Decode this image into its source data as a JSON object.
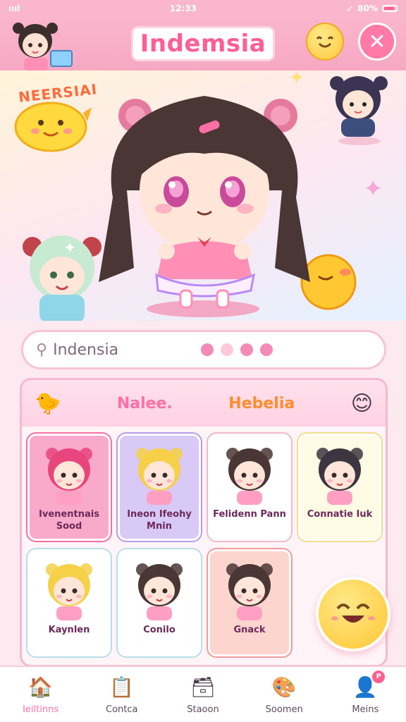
{
  "status_bar": {
    "time": "12:33",
    "battery": "80%"
  },
  "header": {
    "title": "Indemsia"
  },
  "hero": {
    "badge": "NEERSIAI"
  },
  "search": {
    "value": "Indensia"
  },
  "panel": {
    "tabs": [
      {
        "label": "Nalee."
      },
      {
        "label": "Hebelia"
      }
    ],
    "cards": [
      {
        "label": "Ivenentnais Sood",
        "bg": "#f9a9c9",
        "border": "#f56fa3",
        "hair": "#e8457c"
      },
      {
        "label": "Ineon Ifeohy Mnin",
        "bg": "#d8c9f7",
        "border": "#b79be8",
        "hair": "#f6d046"
      },
      {
        "label": "Felidenn Pann",
        "bg": "#ffffff",
        "border": "#f4b7cc",
        "hair": "#4a3634"
      },
      {
        "label": "Connatie Iuk",
        "bg": "#fffbe5",
        "border": "#f1de8a",
        "hair": "#3d3540"
      },
      {
        "label": "Kaynlen",
        "bg": "#ffffff",
        "border": "#b9dde8",
        "hair": "#f6d046"
      },
      {
        "label": "Conilo",
        "bg": "#ffffff",
        "border": "#b9dde8",
        "hair": "#4a3634"
      },
      {
        "label": "Gnack",
        "bg": "#fcd5cf",
        "border": "#f49b9b",
        "hair": "#4a3634"
      }
    ]
  },
  "bottom_nav": [
    {
      "label": "Ieiltinns",
      "icon": "home-icon"
    },
    {
      "label": "Contca",
      "icon": "document-icon"
    },
    {
      "label": "Staoon",
      "icon": "storage-box-icon"
    },
    {
      "label": "Soomen",
      "icon": "paint-icon"
    },
    {
      "label": "Meins",
      "icon": "profile-icon",
      "badge": "P"
    }
  ],
  "colors": {
    "accent": "#ff6fa5",
    "header": "#f9b6cc",
    "panel_border": "#f6b9d0"
  }
}
